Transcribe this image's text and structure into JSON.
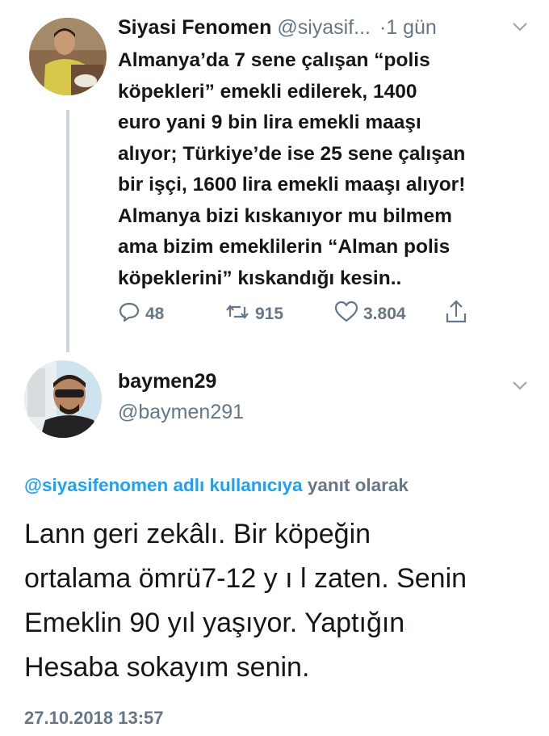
{
  "original_tweet": {
    "display_name": "Siyasi Fenomen",
    "handle": "@siyasif...",
    "time": "·1 gün",
    "lines": [
      "Almanya’da 7 sene çalışan “polis",
      "köpekleri” emekli edilerek, 1400",
      "euro yani 9 bin lira emekli maaşı",
      "alıyor; Türkiye’de ise 25 sene çalışan",
      "bir işçi, 1600 lira emekli maaşı alıyor!",
      "Almanya bizi kıskanıyor mu bilmem",
      "ama bizim emeklilerin “Alman polis",
      "köpeklerini” kıskandığı kesin.."
    ],
    "actions": {
      "replies": "48",
      "retweets": "915",
      "likes": "3.804"
    }
  },
  "reply_tweet": {
    "display_name": "baymen29",
    "handle": "@baymen291",
    "reply_to_mention": "@siyasifenomen adlı kullanıcıya",
    "reply_to_suffix": "yanıt olarak",
    "lines": [
      "Lann geri zekâlı. Bir köpeğin",
      "ortalama ömrü7-12 y ı l zaten. Senin",
      "Emeklin 90 yıl yaşıyor. Yaptığın",
      "Hesaba sokayım senin."
    ],
    "timestamp": "27.10.2018 13:57"
  },
  "colors": {
    "accent": "#1da1f2",
    "secondary_text": "#657786",
    "thread_line": "#ccd6dd"
  }
}
